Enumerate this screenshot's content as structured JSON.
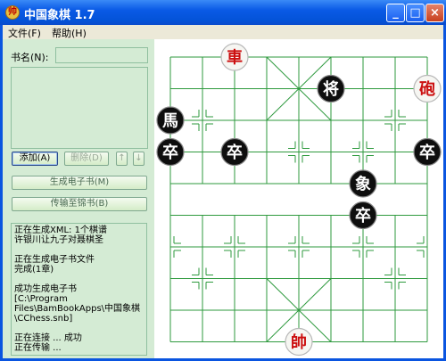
{
  "window": {
    "title": "中国象棋  1.7"
  },
  "title_buttons": {
    "minimize": "_",
    "maximize": "□",
    "close": "×"
  },
  "menu": [
    {
      "label": "文件(F)"
    },
    {
      "label": "帮助(H)"
    }
  ],
  "book": {
    "label": "书名(N):",
    "value": ""
  },
  "buttons": {
    "add": "添加(A)",
    "delete": "删除(D)",
    "up": "↑",
    "down": "↓",
    "generate": "生成电子书(M)",
    "transfer": "传输至锦书(B)"
  },
  "log_lines": [
    "正在生成XML: 1个棋谱",
    "许银川让九子对聂棋圣",
    "",
    "正在生成电子书文件",
    "完成(1章)",
    "",
    "成功生成电子书",
    "[C:\\Program",
    "Files\\BamBookApps\\中国象棋",
    "\\CChess.snb]",
    "",
    "正在连接 ... 成功",
    "正在传输 ..."
  ],
  "colors": {
    "board_line": "#2e9a3e",
    "red_piece": "#cc1010",
    "black_piece": "#111111",
    "panel": "#d4ebd4"
  },
  "pieces": [
    {
      "char": "車",
      "side": "red",
      "file": 2,
      "rank": 0
    },
    {
      "char": "将",
      "side": "black",
      "file": 5,
      "rank": 1
    },
    {
      "char": "砲",
      "side": "red",
      "file": 8,
      "rank": 1
    },
    {
      "char": "馬",
      "side": "black",
      "file": 0,
      "rank": 2
    },
    {
      "char": "卒",
      "side": "black",
      "file": 0,
      "rank": 3
    },
    {
      "char": "卒",
      "side": "black",
      "file": 2,
      "rank": 3
    },
    {
      "char": "卒",
      "side": "black",
      "file": 8,
      "rank": 3
    },
    {
      "char": "象",
      "side": "black",
      "file": 6,
      "rank": 4
    },
    {
      "char": "卒",
      "side": "black",
      "file": 6,
      "rank": 5
    },
    {
      "char": "帥",
      "side": "red",
      "file": 4,
      "rank": 9
    }
  ]
}
